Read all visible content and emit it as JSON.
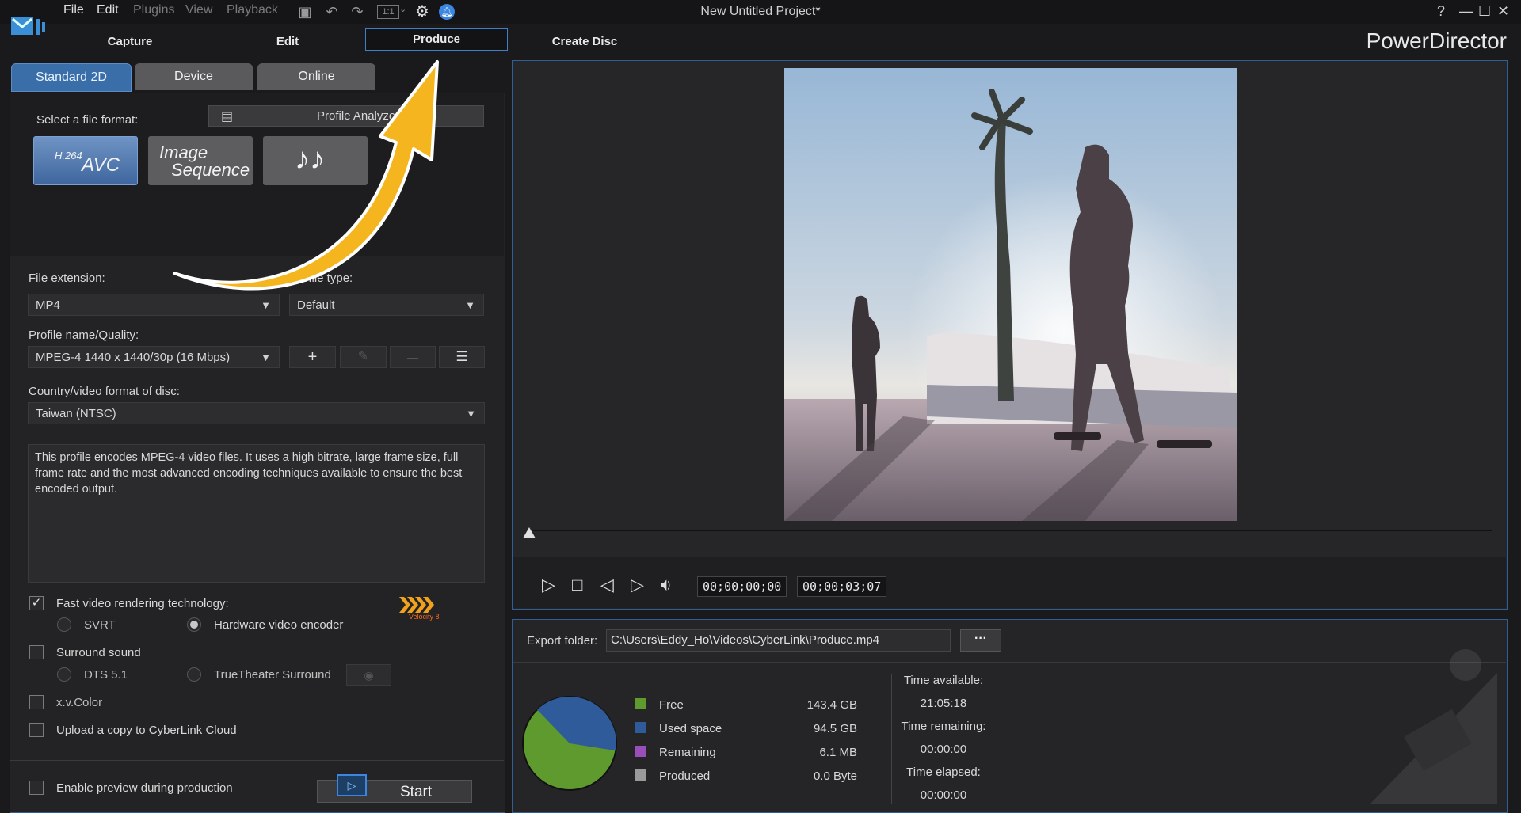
{
  "window": {
    "title": "New Untitled Project*",
    "brand": "PowerDirector",
    "help": "?",
    "minimize": "—",
    "maximize": "☐",
    "close": "✕"
  },
  "menu": [
    "File",
    "Edit",
    "Plugins",
    "View",
    "Playback"
  ],
  "toolbar": {
    "zoom_label": "1:1"
  },
  "main_tabs": [
    "Capture",
    "Edit",
    "Produce",
    "Create Disc"
  ],
  "sub_tabs": [
    "Standard 2D",
    "Device",
    "Online"
  ],
  "format": {
    "label": "Select a file format:",
    "profile_analyzer": "Profile Analyzer",
    "h264_small": "H.264",
    "h264_big": "AVC",
    "image_line1": "Image",
    "image_line2": "Sequence",
    "audio_glyph": "♪♪"
  },
  "file_extension": {
    "label": "File extension:",
    "value": "MP4"
  },
  "profile_type": {
    "label": "Profile type:",
    "value": "Default"
  },
  "profile_quality": {
    "label": "Profile name/Quality:",
    "value": "MPEG-4 1440 x 1440/30p (16 Mbps)"
  },
  "profile_buttons": {
    "add": "+",
    "edit": "✎",
    "remove": "—",
    "details": "☰"
  },
  "country": {
    "label": "Country/video format of disc:",
    "value": "Taiwan (NTSC)"
  },
  "description": "This profile encodes MPEG-4 video files. It uses a high bitrate, large frame size, full frame rate and the most advanced encoding techniques available to ensure the best encoded output.",
  "options": {
    "fast_render": {
      "label": "Fast video rendering technology:",
      "checked": true
    },
    "svrt": "SVRT",
    "hardware_encoder": "Hardware video encoder",
    "velocity": "Velocity 8",
    "surround": "Surround sound",
    "dts": "DTS 5.1",
    "truetheater": "TrueTheater Surround",
    "xvcolor": "x.v.Color",
    "upload": "Upload a copy to CyberLink Cloud",
    "enable_preview": "Enable preview during production",
    "start": "Start"
  },
  "playback": {
    "current_time": "00;00;00;00",
    "total_time": "00;00;03;07"
  },
  "export": {
    "label": "Export folder:",
    "path": "C:\\Users\\Eddy_Ho\\Videos\\CyberLink\\Produce.mp4",
    "browse": "···"
  },
  "disk": {
    "legend": [
      {
        "label": "Free",
        "value": "143.4  GB",
        "color": "#5f9a2e"
      },
      {
        "label": "Used space",
        "value": "94.5  GB",
        "color": "#2f5b9a"
      },
      {
        "label": "Remaining",
        "value": "6.1  MB",
        "color": "#9a4fb8"
      },
      {
        "label": "Produced",
        "value": "0.0  Byte",
        "color": "#9a9a9a"
      }
    ],
    "free_gb": 143.4,
    "used_gb": 94.5
  },
  "times": {
    "available_label": "Time available:",
    "available": "21:05:18",
    "remaining_label": "Time remaining:",
    "remaining": "00:00:00",
    "elapsed_label": "Time elapsed:",
    "elapsed": "00:00:00"
  }
}
